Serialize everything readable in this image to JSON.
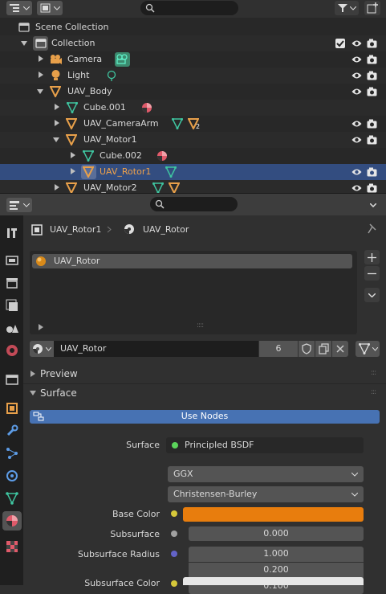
{
  "outliner": {
    "rows": [
      {
        "label": "Scene Collection"
      },
      {
        "label": "Collection"
      },
      {
        "label": "Camera"
      },
      {
        "label": "Light"
      },
      {
        "label": "UAV_Body"
      },
      {
        "label": "Cube.001"
      },
      {
        "label": "UAV_CameraArm",
        "badge": "2"
      },
      {
        "label": "UAV_Motor1"
      },
      {
        "label": "Cube.002"
      },
      {
        "label": "UAV_Rotor1"
      },
      {
        "label": "UAV_Motor2"
      }
    ]
  },
  "properties": {
    "breadcrumb": {
      "object": "UAV_Rotor1",
      "material": "UAV_Rotor"
    },
    "slot_list": [
      {
        "label": "UAV_Rotor"
      }
    ],
    "material_name": "UAV_Rotor",
    "user_count": "6",
    "panels": {
      "preview": "Preview",
      "surface": "Surface"
    },
    "use_nodes_label": "Use Nodes",
    "surface": {
      "label": "Surface",
      "shader": "Principled BSDF",
      "distribution": "GGX",
      "subsurface_method": "Christensen-Burley",
      "base_color_label": "Base Color",
      "base_color": "#e87d0d",
      "subsurface_label": "Subsurface",
      "subsurface_value": "0.000",
      "subsurface_radius_label": "Subsurface Radius",
      "subsurface_radius": [
        "1.000",
        "0.200",
        "0.100"
      ],
      "subsurface_color_label": "Subsurface Color",
      "subsurface_color": "#e6e6e6"
    }
  },
  "colors": {
    "selected_row": "#334d80",
    "active_text": "#f0a24a",
    "use_nodes": "#4772b3",
    "mesh_icon": "#3fc5a0",
    "object_icon": "#e8a04a"
  }
}
